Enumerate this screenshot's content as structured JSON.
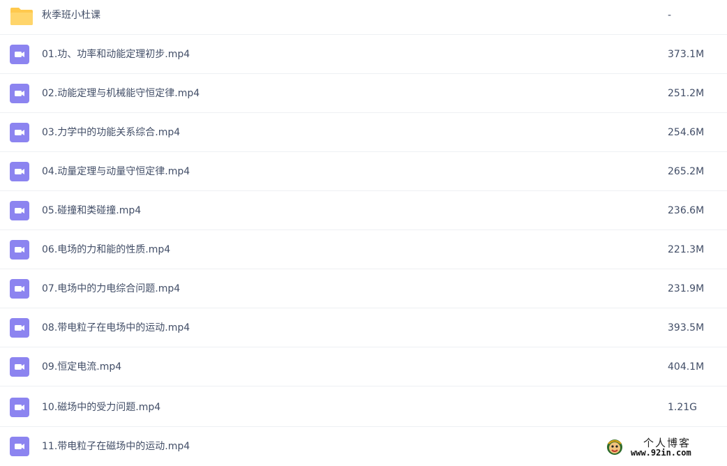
{
  "icons": {
    "folder": "folder-icon",
    "video": "video-file-icon"
  },
  "colors": {
    "folder": "#ffc94d",
    "video": "#8c84f0",
    "text": "#424e67",
    "divider": "#eef0f3"
  },
  "files": [
    {
      "type": "folder",
      "name": "秋季班小杜课",
      "size": "-"
    },
    {
      "type": "video",
      "name": "01.功、功率和动能定理初步.mp4",
      "size": "373.1M"
    },
    {
      "type": "video",
      "name": "02.动能定理与机械能守恒定律.mp4",
      "size": "251.2M"
    },
    {
      "type": "video",
      "name": "03.力学中的功能关系综合.mp4",
      "size": "254.6M"
    },
    {
      "type": "video",
      "name": "04.动量定理与动量守恒定律.mp4",
      "size": "265.2M"
    },
    {
      "type": "video",
      "name": "05.碰撞和类碰撞.mp4",
      "size": "236.6M"
    },
    {
      "type": "video",
      "name": "06.电场的力和能的性质.mp4",
      "size": "221.3M"
    },
    {
      "type": "video",
      "name": "07.电场中的力电综合问题.mp4",
      "size": "231.9M"
    },
    {
      "type": "video",
      "name": "08.带电粒子在电场中的运动.mp4",
      "size": "393.5M"
    },
    {
      "type": "video",
      "name": "09.恒定电流.mp4",
      "size": "404.1M"
    },
    {
      "type": "video",
      "name": "10.磁场中的受力问题.mp4",
      "size": "1.21G"
    },
    {
      "type": "video",
      "name": "11.带电粒子在磁场中的运动.mp4",
      "size": ""
    }
  ],
  "watermark": {
    "title": "个人博客",
    "url": "www.92in.com"
  }
}
